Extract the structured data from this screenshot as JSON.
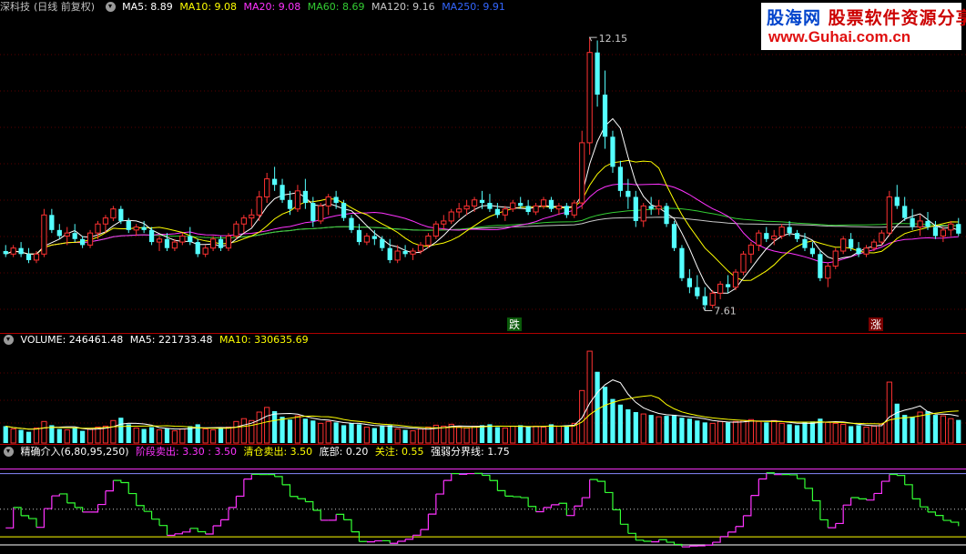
{
  "kline_panel": {
    "stock_name": "深科技",
    "period_label": "(日线 前复权)",
    "ma_values": [
      {
        "label": "MA5: 8.89",
        "color": "#ffffff"
      },
      {
        "label": "MA10: 9.08",
        "color": "#ffff00"
      },
      {
        "label": "MA20: 9.08",
        "color": "#ff33ff"
      },
      {
        "label": "MA60: 8.69",
        "color": "#33cc33"
      },
      {
        "label": "MA120: 9.16",
        "color": "#c8c8c8"
      },
      {
        "label": "MA250: 9.91",
        "color": "#3366ff"
      }
    ],
    "high_label": "12.15",
    "low_label": "7.61",
    "marker_down": "跌",
    "marker_up": "涨"
  },
  "volume_panel": {
    "volume_label": "VOLUME: 246461.48",
    "ma5_label": "MA5: 221733.48",
    "ma10_label": "MA10: 330635.69"
  },
  "indicator_panel": {
    "title": "精确介入(6,80,95,250)",
    "stage_sell_label": "阶段卖出: 3.30 : 3.50",
    "clear_sell_label": "清仓卖出: 3.50",
    "bottom_label": "底部: 0.20",
    "focus_label": "关注: 0.55",
    "boundary_label": "强弱分界线: 1.75"
  },
  "logo": {
    "cn_main": "股海网",
    "cn_sub": "股票软件资源分享",
    "url": "www.Guhai.com.cn"
  },
  "colors": {
    "up": "#ff3232",
    "down": "#54ffff",
    "ma5": "#ffffff",
    "ma10": "#ffff00",
    "ma20": "#ff33ff",
    "ma60": "#33cc33",
    "ma120": "#c8c8c8",
    "indicator_up": "#ff33ff",
    "indicator_down": "#33ff33"
  },
  "chart_data": {
    "type": "candlestick",
    "price_range": [
      7.3,
      12.5
    ],
    "candles": [
      [
        8.6,
        8.7,
        8.5,
        8.55
      ],
      [
        8.55,
        8.7,
        8.5,
        8.65
      ],
      [
        8.65,
        8.75,
        8.5,
        8.55
      ],
      [
        8.55,
        8.65,
        8.4,
        8.45
      ],
      [
        8.45,
        8.6,
        8.4,
        8.55
      ],
      [
        8.55,
        9.3,
        8.5,
        9.2
      ],
      [
        9.2,
        9.3,
        8.9,
        8.95
      ],
      [
        8.95,
        9.05,
        8.8,
        8.85
      ],
      [
        8.85,
        9.0,
        8.7,
        8.9
      ],
      [
        8.9,
        9.05,
        8.75,
        8.8
      ],
      [
        8.8,
        8.85,
        8.65,
        8.7
      ],
      [
        8.7,
        8.95,
        8.65,
        8.9
      ],
      [
        8.9,
        9.1,
        8.8,
        9.05
      ],
      [
        9.05,
        9.2,
        8.9,
        9.15
      ],
      [
        9.15,
        9.35,
        9.1,
        9.3
      ],
      [
        9.3,
        9.35,
        9.05,
        9.1
      ],
      [
        9.1,
        9.15,
        8.9,
        8.95
      ],
      [
        8.95,
        9.05,
        8.85,
        9.0
      ],
      [
        9.0,
        9.1,
        8.9,
        8.95
      ],
      [
        8.95,
        9.0,
        8.7,
        8.75
      ],
      [
        8.75,
        8.85,
        8.6,
        8.8
      ],
      [
        8.8,
        8.9,
        8.6,
        8.65
      ],
      [
        8.65,
        8.8,
        8.6,
        8.75
      ],
      [
        8.75,
        8.9,
        8.7,
        8.85
      ],
      [
        8.85,
        9.0,
        8.7,
        8.75
      ],
      [
        8.75,
        8.8,
        8.5,
        8.55
      ],
      [
        8.55,
        8.7,
        8.5,
        8.65
      ],
      [
        8.65,
        8.85,
        8.6,
        8.8
      ],
      [
        8.8,
        8.85,
        8.6,
        8.65
      ],
      [
        8.65,
        8.9,
        8.6,
        8.85
      ],
      [
        8.85,
        9.1,
        8.8,
        9.05
      ],
      [
        9.05,
        9.2,
        8.9,
        9.15
      ],
      [
        9.15,
        9.3,
        9.0,
        9.2
      ],
      [
        9.2,
        9.6,
        9.1,
        9.5
      ],
      [
        9.5,
        9.9,
        9.4,
        9.8
      ],
      [
        9.8,
        10.0,
        9.6,
        9.7
      ],
      [
        9.7,
        9.8,
        9.4,
        9.45
      ],
      [
        9.45,
        9.6,
        9.2,
        9.3
      ],
      [
        9.3,
        9.7,
        9.25,
        9.6
      ],
      [
        9.6,
        9.8,
        9.3,
        9.4
      ],
      [
        9.4,
        9.5,
        9.0,
        9.1
      ],
      [
        9.1,
        9.4,
        9.05,
        9.35
      ],
      [
        9.35,
        9.55,
        9.2,
        9.5
      ],
      [
        9.5,
        9.6,
        9.3,
        9.4
      ],
      [
        9.4,
        9.45,
        9.1,
        9.15
      ],
      [
        9.15,
        9.2,
        8.9,
        8.95
      ],
      [
        8.95,
        9.05,
        8.7,
        8.75
      ],
      [
        8.75,
        8.9,
        8.7,
        8.85
      ],
      [
        8.85,
        8.95,
        8.7,
        8.8
      ],
      [
        8.8,
        8.85,
        8.6,
        8.65
      ],
      [
        8.65,
        8.8,
        8.4,
        8.45
      ],
      [
        8.45,
        8.7,
        8.4,
        8.6
      ],
      [
        8.6,
        8.7,
        8.5,
        8.55
      ],
      [
        8.55,
        8.65,
        8.45,
        8.6
      ],
      [
        8.6,
        8.75,
        8.55,
        8.7
      ],
      [
        8.7,
        8.9,
        8.65,
        8.85
      ],
      [
        8.85,
        9.1,
        8.8,
        9.05
      ],
      [
        9.05,
        9.2,
        8.95,
        9.1
      ],
      [
        9.1,
        9.3,
        9.05,
        9.25
      ],
      [
        9.25,
        9.4,
        9.15,
        9.3
      ],
      [
        9.3,
        9.45,
        9.2,
        9.35
      ],
      [
        9.35,
        9.5,
        9.25,
        9.45
      ],
      [
        9.45,
        9.6,
        9.3,
        9.4
      ],
      [
        9.4,
        9.55,
        9.25,
        9.3
      ],
      [
        9.3,
        9.4,
        9.15,
        9.2
      ],
      [
        9.2,
        9.35,
        9.1,
        9.3
      ],
      [
        9.3,
        9.45,
        9.25,
        9.4
      ],
      [
        9.4,
        9.5,
        9.3,
        9.35
      ],
      [
        9.35,
        9.45,
        9.2,
        9.25
      ],
      [
        9.25,
        9.4,
        9.2,
        9.35
      ],
      [
        9.35,
        9.5,
        9.3,
        9.45
      ],
      [
        9.45,
        9.5,
        9.25,
        9.3
      ],
      [
        9.3,
        9.4,
        9.2,
        9.35
      ],
      [
        9.35,
        9.4,
        9.15,
        9.2
      ],
      [
        9.2,
        9.45,
        9.15,
        9.4
      ],
      [
        9.4,
        10.6,
        9.3,
        10.4
      ],
      [
        10.4,
        12.15,
        10.2,
        11.9
      ],
      [
        11.9,
        12.1,
        11.0,
        11.2
      ],
      [
        11.2,
        11.6,
        10.3,
        10.5
      ],
      [
        10.5,
        10.6,
        9.9,
        10.0
      ],
      [
        10.0,
        10.1,
        9.5,
        9.6
      ],
      [
        9.6,
        9.8,
        9.3,
        9.5
      ],
      [
        9.5,
        9.6,
        9.0,
        9.1
      ],
      [
        9.1,
        9.4,
        9.0,
        9.35
      ],
      [
        9.35,
        9.5,
        9.2,
        9.3
      ],
      [
        9.3,
        9.45,
        9.2,
        9.35
      ],
      [
        9.35,
        9.4,
        9.0,
        9.05
      ],
      [
        9.05,
        9.1,
        8.6,
        8.65
      ],
      [
        8.65,
        8.7,
        8.1,
        8.15
      ],
      [
        8.15,
        8.3,
        7.9,
        8.0
      ],
      [
        8.0,
        8.2,
        7.8,
        7.85
      ],
      [
        7.85,
        8.0,
        7.61,
        7.7
      ],
      [
        7.7,
        7.95,
        7.65,
        7.9
      ],
      [
        7.9,
        8.1,
        7.8,
        8.05
      ],
      [
        8.05,
        8.2,
        7.9,
        8.0
      ],
      [
        8.0,
        8.3,
        7.95,
        8.25
      ],
      [
        8.25,
        8.6,
        8.2,
        8.55
      ],
      [
        8.55,
        8.75,
        8.4,
        8.7
      ],
      [
        8.7,
        8.95,
        8.6,
        8.9
      ],
      [
        8.9,
        9.0,
        8.75,
        8.8
      ],
      [
        8.8,
        8.95,
        8.7,
        8.85
      ],
      [
        8.85,
        9.05,
        8.8,
        9.0
      ],
      [
        9.0,
        9.1,
        8.85,
        8.9
      ],
      [
        8.9,
        8.95,
        8.75,
        8.8
      ],
      [
        8.8,
        8.9,
        8.6,
        8.65
      ],
      [
        8.65,
        8.75,
        8.5,
        8.55
      ],
      [
        8.55,
        8.6,
        8.1,
        8.15
      ],
      [
        8.15,
        8.4,
        8.0,
        8.35
      ],
      [
        8.35,
        8.65,
        8.3,
        8.6
      ],
      [
        8.6,
        8.85,
        8.55,
        8.8
      ],
      [
        8.8,
        8.9,
        8.6,
        8.65
      ],
      [
        8.65,
        8.75,
        8.5,
        8.55
      ],
      [
        8.55,
        8.7,
        8.5,
        8.65
      ],
      [
        8.65,
        8.8,
        8.6,
        8.75
      ],
      [
        8.75,
        8.95,
        8.7,
        8.9
      ],
      [
        8.9,
        9.6,
        8.85,
        9.5
      ],
      [
        9.5,
        9.7,
        9.3,
        9.35
      ],
      [
        9.35,
        9.5,
        9.1,
        9.15
      ],
      [
        9.15,
        9.3,
        8.95,
        9.0
      ],
      [
        9.0,
        9.2,
        8.85,
        9.1
      ],
      [
        9.1,
        9.25,
        8.95,
        9.0
      ],
      [
        9.0,
        9.1,
        8.8,
        8.85
      ],
      [
        8.85,
        9.0,
        8.75,
        8.95
      ],
      [
        8.95,
        9.1,
        8.85,
        9.05
      ],
      [
        9.05,
        9.15,
        8.85,
        8.89
      ]
    ],
    "volume_range": [
      0,
      1000000
    ],
    "volumes": [
      180000,
      150000,
      140000,
      120000,
      160000,
      230000,
      190000,
      150000,
      140000,
      160000,
      130000,
      150000,
      170000,
      180000,
      240000,
      270000,
      200000,
      160000,
      150000,
      170000,
      140000,
      160000,
      130000,
      150000,
      180000,
      200000,
      150000,
      140000,
      160000,
      170000,
      230000,
      260000,
      240000,
      330000,
      380000,
      340000,
      280000,
      250000,
      290000,
      260000,
      240000,
      210000,
      230000,
      220000,
      190000,
      210000,
      200000,
      170000,
      160000,
      180000,
      190000,
      150000,
      140000,
      130000,
      150000,
      170000,
      190000,
      180000,
      200000,
      170000,
      160000,
      180000,
      190000,
      200000,
      170000,
      160000,
      180000,
      190000,
      170000,
      180000,
      170000,
      200000,
      180000,
      190000,
      210000,
      560000,
      980000,
      760000,
      600000,
      470000,
      410000,
      360000,
      330000,
      310000,
      300000,
      280000,
      290000,
      300000,
      270000,
      260000,
      240000,
      220000,
      210000,
      230000,
      220000,
      230000,
      240000,
      250000,
      230000,
      220000,
      240000,
      210000,
      200000,
      190000,
      220000,
      230000,
      260000,
      220000,
      210000,
      200000,
      180000,
      190000,
      170000,
      180000,
      200000,
      650000,
      420000,
      300000,
      280000,
      330000,
      340000,
      300000,
      290000,
      260000,
      246461
    ],
    "indicator_range": [
      0,
      3.8
    ]
  }
}
